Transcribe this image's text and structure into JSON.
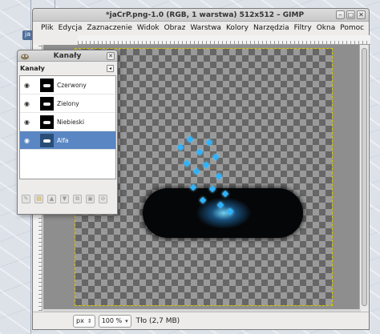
{
  "window": {
    "title": "*jaCrP.png-1.0 (RGB, 1 warstwa) 512x512 – GIMP",
    "controls": [
      "–",
      "□",
      "✕"
    ]
  },
  "menubar": {
    "items": [
      "Plik",
      "Edycja",
      "Zaznaczenie",
      "Widok",
      "Obraz",
      "Warstwa",
      "Kolory",
      "Narzędzia",
      "Filtry",
      "Okna",
      "Pomoc"
    ]
  },
  "desktop": {
    "tag_label": "ja"
  },
  "channels_dialog": {
    "title": "Kanały",
    "header": "Kanały",
    "channels": [
      {
        "name": "Czerwony"
      },
      {
        "name": "Zielony"
      },
      {
        "name": "Niebieski"
      },
      {
        "name": "Alfa",
        "selected": true
      }
    ],
    "tools": [
      "edit-channel-icon",
      "new-channel-icon",
      "raise-channel-icon",
      "lower-channel-icon",
      "duplicate-channel-icon",
      "channel-to-selection-icon",
      "delete-channel-icon"
    ]
  },
  "statusbar": {
    "unit": "px",
    "zoom": "100 %",
    "layer_info": "Tło (2,7 MB)"
  }
}
